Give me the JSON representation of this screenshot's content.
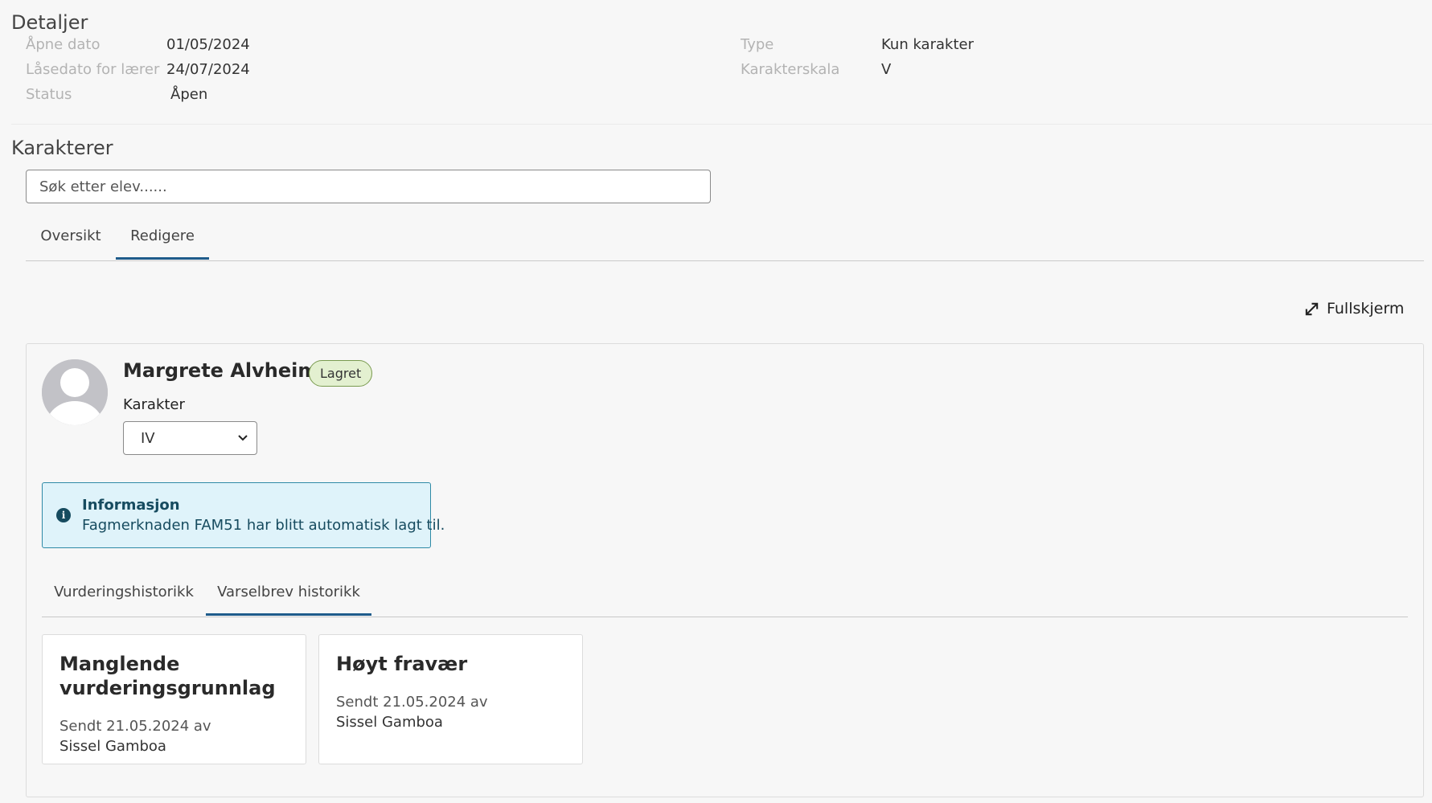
{
  "details": {
    "heading": "Detaljer",
    "left": [
      {
        "label": "Åpne dato",
        "value": "01/05/2024"
      },
      {
        "label": "Låsedato for lærer",
        "value": "24/07/2024"
      },
      {
        "label": "Status",
        "value": "Åpen"
      }
    ],
    "right": [
      {
        "label": "Type",
        "value": "Kun karakter"
      },
      {
        "label": "Karakterskala",
        "value": "V"
      }
    ]
  },
  "grades": {
    "heading": "Karakterer",
    "search_placeholder": "Søk etter elev......",
    "tabs": [
      {
        "label": "Oversikt",
        "active": false
      },
      {
        "label": "Redigere",
        "active": true
      }
    ],
    "fullscreen_label": "Fullskjerm",
    "fullscreen_icon": "expand-arrows-icon"
  },
  "student": {
    "name": "Margrete Alvheim",
    "status_badge": "Lagret",
    "grade_label": "Karakter",
    "grade_value": "IV",
    "avatar_icon": "user-avatar-icon"
  },
  "info": {
    "title": "Informasjon",
    "text": "Fagmerknaden FAM51 har blitt automatisk lagt til.",
    "icon": "info-icon",
    "icon_glyph": "i"
  },
  "history": {
    "tabs": [
      {
        "label": "Vurderingshistorikk",
        "active": false
      },
      {
        "label": "Varselbrev historikk",
        "active": true
      }
    ],
    "letters": [
      {
        "title": "Manglende vurderingsgrunnlag",
        "sent": "Sendt 21.05.2024 av",
        "by": "Sissel Gamboa"
      },
      {
        "title": "Høyt fravær",
        "sent": "Sendt 21.05.2024 av",
        "by": "Sissel Gamboa"
      }
    ]
  },
  "colors": {
    "accent": "#1f5c8b",
    "badge_bg": "#e3f0d0",
    "info_bg": "#dff3fa",
    "info_text": "#164b5f"
  }
}
